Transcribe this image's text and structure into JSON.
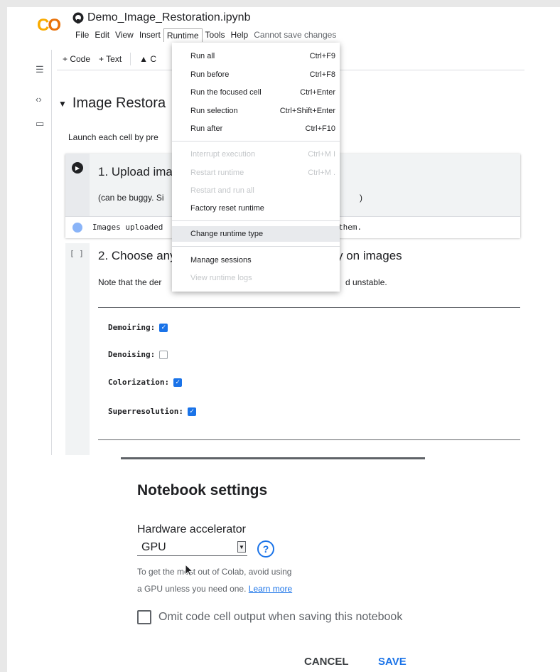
{
  "app": {
    "logo": "CO",
    "notebook_title": "Demo_Image_Restoration.ipynb"
  },
  "menubar": {
    "items": [
      "File",
      "Edit",
      "View",
      "Insert",
      "Runtime",
      "Tools",
      "Help"
    ],
    "active": "Runtime",
    "save_note": "Cannot save changes"
  },
  "toolbar": {
    "add_code": "+ Code",
    "add_text": "+ Text",
    "drive_label": "C"
  },
  "rail": {
    "icons": [
      "list-icon",
      "code-icon",
      "folder-icon"
    ]
  },
  "section": {
    "title": "Image Restora",
    "intro": "Launch each cell by pre"
  },
  "cell1": {
    "title": "1. Upload ima",
    "sub_left": "(can be buggy. Si",
    "sub_right": ")",
    "output_left": "Images uploaded",
    "output_right": "them."
  },
  "cell2": {
    "bracket": "[ ]",
    "title_left": "2. Choose any",
    "title_right": "y on images",
    "note_left": "Note that the der",
    "note_right": "d unstable.",
    "options": [
      {
        "label": "Demoiring:",
        "checked": true
      },
      {
        "label": "Denoising:",
        "checked": false
      },
      {
        "label": "Colorization:",
        "checked": true
      },
      {
        "label": "Superresolution:",
        "checked": true
      }
    ]
  },
  "runtime_menu": {
    "items": [
      {
        "label": "Run all",
        "shortcut": "Ctrl+F9",
        "disabled": false
      },
      {
        "label": "Run before",
        "shortcut": "Ctrl+F8",
        "disabled": false
      },
      {
        "label": "Run the focused cell",
        "shortcut": "Ctrl+Enter",
        "disabled": false
      },
      {
        "label": "Run selection",
        "shortcut": "Ctrl+Shift+Enter",
        "disabled": false
      },
      {
        "label": "Run after",
        "shortcut": "Ctrl+F10",
        "disabled": false
      },
      {
        "label": "Interrupt execution",
        "shortcut": "Ctrl+M I",
        "disabled": true
      },
      {
        "label": "Restart runtime",
        "shortcut": "Ctrl+M .",
        "disabled": true
      },
      {
        "label": "Restart and run all",
        "shortcut": "",
        "disabled": true
      },
      {
        "label": "Factory reset runtime",
        "shortcut": "",
        "disabled": false
      },
      {
        "label": "Change runtime type",
        "shortcut": "",
        "disabled": false,
        "highlighted": true
      },
      {
        "label": "Manage sessions",
        "shortcut": "",
        "disabled": false
      },
      {
        "label": "View runtime logs",
        "shortcut": "",
        "disabled": true
      }
    ]
  },
  "dialog": {
    "title": "Notebook settings",
    "hardware_label": "Hardware accelerator",
    "hardware_value": "GPU",
    "hint_line1": "To get the most out of Colab, avoid using",
    "hint_line2_prefix": "a GPU unless you need one.",
    "learn_more": "Learn more",
    "omit_label": "Omit code cell output when saving this notebook",
    "cancel": "CANCEL",
    "save": "SAVE"
  }
}
